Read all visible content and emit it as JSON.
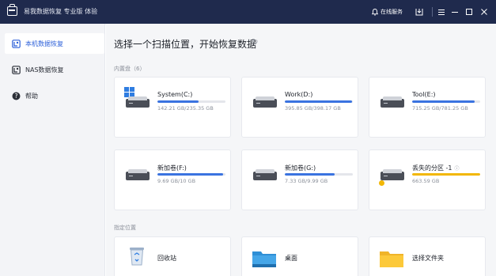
{
  "titlebar": {
    "title": "易我数据恢复 专业版 体验",
    "service_label": "在线服务",
    "bg_color": "#1f2a4d"
  },
  "sidebar": {
    "items": [
      {
        "label": "本机数据恢复",
        "icon": "local-recovery-icon",
        "active": true
      },
      {
        "label": "NAS数据恢复",
        "icon": "nas-recovery-icon",
        "active": false
      },
      {
        "label": "帮助",
        "icon": "help-icon",
        "active": false
      }
    ]
  },
  "main": {
    "heading": "选择一个扫描位置，开始恢复数据",
    "disks_label": "内置盘（6）",
    "locations_label": "指定位置",
    "accent_color": "#3a73e0",
    "warn_color": "#f2b705",
    "drives": [
      {
        "name": "System(C:)",
        "size": "142.21 GB/235.35 GB",
        "used_fraction": 0.6,
        "icon": "system-drive-icon"
      },
      {
        "name": "Work(D:)",
        "size": "395.85 GB/398.17 GB",
        "used_fraction": 0.99,
        "icon": "hard-drive-icon"
      },
      {
        "name": "Tool(E:)",
        "size": "715.25 GB/781.25 GB",
        "used_fraction": 0.92,
        "icon": "hard-drive-icon"
      },
      {
        "name": "新加卷(F:)",
        "size": "9.69 GB/10 GB",
        "used_fraction": 0.97,
        "icon": "hard-drive-icon"
      },
      {
        "name": "新加卷(G:)",
        "size": "7.33 GB/9.99 GB",
        "used_fraction": 0.73,
        "icon": "hard-drive-icon"
      },
      {
        "name": "丢失的分区 -1",
        "size": "663.59 GB",
        "used_fraction": 1.0,
        "icon": "lost-partition-icon"
      }
    ],
    "locations": [
      {
        "name": "回收站",
        "icon": "recycle-bin-icon"
      },
      {
        "name": "桌面",
        "icon": "desktop-folder-icon"
      },
      {
        "name": "选择文件夹",
        "icon": "folder-icon"
      }
    ]
  }
}
